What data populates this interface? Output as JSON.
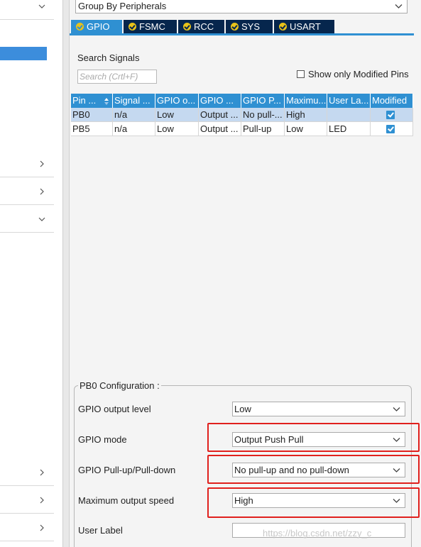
{
  "sidebar": {
    "selected_item": "",
    "rows": [
      {
        "chevron": "chevron-down"
      },
      {
        "chevron": "chevron-right"
      },
      {
        "chevron": "chevron-right"
      },
      {
        "chevron": "chevron-down"
      },
      {
        "chevron": "chevron-right"
      },
      {
        "chevron": "chevron-right"
      },
      {
        "chevron": "chevron-right"
      }
    ]
  },
  "group_by": {
    "value": "Group By Peripherals"
  },
  "tabs": [
    {
      "label": "GPIO",
      "active": true
    },
    {
      "label": "FSMC",
      "active": false
    },
    {
      "label": "RCC",
      "active": false
    },
    {
      "label": "SYS",
      "active": false
    },
    {
      "label": "USART",
      "active": false
    }
  ],
  "signals": {
    "label": "Search Signals",
    "placeholder": "Search (Crtl+F)",
    "show_modified_label": "Show only Modified Pins"
  },
  "table": {
    "headers": [
      "Pin ...",
      "Signal ...",
      "GPIO o...",
      "GPIO ...",
      "GPIO P...",
      "Maximu...",
      "User La...",
      "Modified"
    ],
    "rows": [
      {
        "pin": "PB0",
        "signal": "n/a",
        "gpio_output": "Low",
        "gpio_mode": "Output ...",
        "gpio_pull": "No pull-...",
        "max_speed": "High",
        "user_label": "",
        "modified": true
      },
      {
        "pin": "PB5",
        "signal": "n/a",
        "gpio_output": "Low",
        "gpio_mode": "Output ...",
        "gpio_pull": "Pull-up",
        "max_speed": "Low",
        "user_label": "LED",
        "modified": true
      }
    ]
  },
  "config": {
    "title": "PB0 Configuration :",
    "fields": [
      {
        "label": "GPIO output level",
        "value": "Low",
        "type": "select"
      },
      {
        "label": "GPIO mode",
        "value": "Output Push Pull",
        "type": "select"
      },
      {
        "label": "GPIO Pull-up/Pull-down",
        "value": "No pull-up and no pull-down",
        "type": "select"
      },
      {
        "label": "Maximum output speed",
        "value": "High",
        "type": "select"
      },
      {
        "label": "User Label",
        "value": "",
        "type": "input"
      }
    ]
  },
  "watermark": "https://blog.csdn.net/zzy_c",
  "colors": {
    "accent": "#2f90d2",
    "tab_bg": "#06264d",
    "highlight": "#e0201d",
    "selected_row": "#c5d9f0"
  }
}
